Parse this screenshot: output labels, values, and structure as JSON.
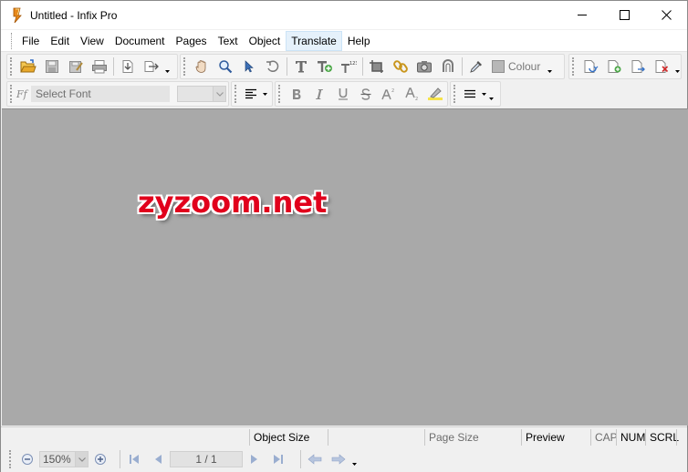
{
  "window": {
    "title": "Untitled - Infix Pro",
    "controls": {
      "minimize": "minimize",
      "maximize": "maximize",
      "close": "close"
    }
  },
  "menu": {
    "items": [
      "File",
      "Edit",
      "View",
      "Document",
      "Pages",
      "Text",
      "Object",
      "Translate",
      "Help"
    ],
    "active": "Translate"
  },
  "toolbar": {
    "colour_label": "Colour",
    "font_placeholder": "Select Font",
    "font_prefix": "Ff",
    "size_value": ""
  },
  "workspace": {
    "watermark": "zyzoom.net",
    "background_color": "#a9a9a9",
    "watermark_color": "#e1001c"
  },
  "statusbar": {
    "object_size": "Object Size",
    "page_size": "Page Size",
    "preview": "Preview",
    "cap": "CAP",
    "num": "NUM",
    "scrl": "SCRL"
  },
  "navbar": {
    "zoom": "150%",
    "page": "1 / 1"
  }
}
